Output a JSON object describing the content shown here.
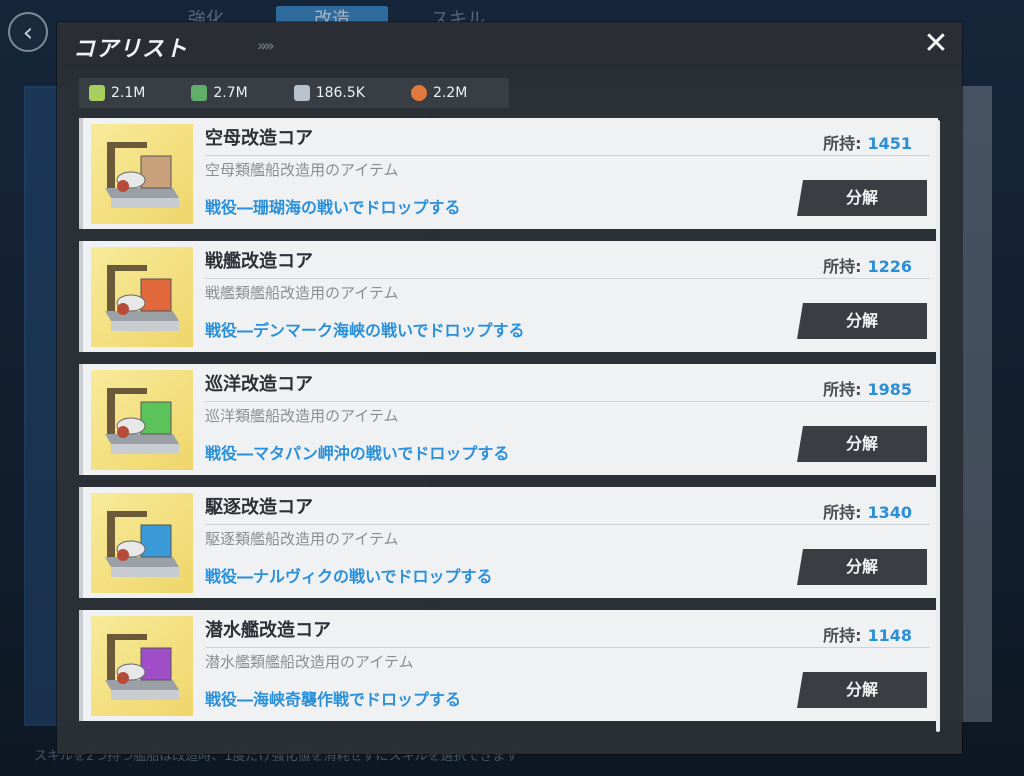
{
  "background": {
    "back_icon": "chevron-left-icon",
    "tabs": [
      "強化",
      "改造",
      "スキル"
    ],
    "bottom_hint": "スキルを2つ持つ艦船は改造時、1度だけ強化値を消耗せずにスキルを選択できます"
  },
  "modal": {
    "title": "コアリスト",
    "chevrons": "»»",
    "close_icon": "close-icon",
    "close_glyph": "✕"
  },
  "resources": [
    {
      "icon": "fuel-icon",
      "color": "#a6cf5e",
      "value": "2.1M"
    },
    {
      "icon": "ammo-icon",
      "color": "#5fae6a",
      "value": "2.7M"
    },
    {
      "icon": "steel-icon",
      "color": "#b9c2cc",
      "value": "186.5K"
    },
    {
      "icon": "aluminium-icon",
      "color": "#e0793b",
      "value": "2.2M"
    }
  ],
  "owned_label": "所持:",
  "dismantle_label": "分解",
  "items": [
    {
      "name": "空母改造コア",
      "owned": "1451",
      "desc": "空母類艦船改造用のアイテム",
      "source": "戦役―珊瑚海の戦いでドロップする",
      "accent": "#c8a07a"
    },
    {
      "name": "戦艦改造コア",
      "owned": "1226",
      "desc": "戦艦類艦船改造用のアイテム",
      "source": "戦役―デンマーク海峡の戦いでドロップする",
      "accent": "#e0683a"
    },
    {
      "name": "巡洋改造コア",
      "owned": "1985",
      "desc": "巡洋類艦船改造用のアイテム",
      "source": "戦役―マタパン岬沖の戦いでドロップする",
      "accent": "#5cc25a"
    },
    {
      "name": "駆逐改造コア",
      "owned": "1340",
      "desc": "駆逐類艦船改造用のアイテム",
      "source": "戦役―ナルヴィクの戦いでドロップする",
      "accent": "#3a9ad8"
    },
    {
      "name": "潜水艦改造コア",
      "owned": "1148",
      "desc": "潜水艦類艦船改造用のアイテム",
      "source": "戦役―海峡奇襲作戦でドロップする",
      "accent": "#a04ec8"
    }
  ]
}
